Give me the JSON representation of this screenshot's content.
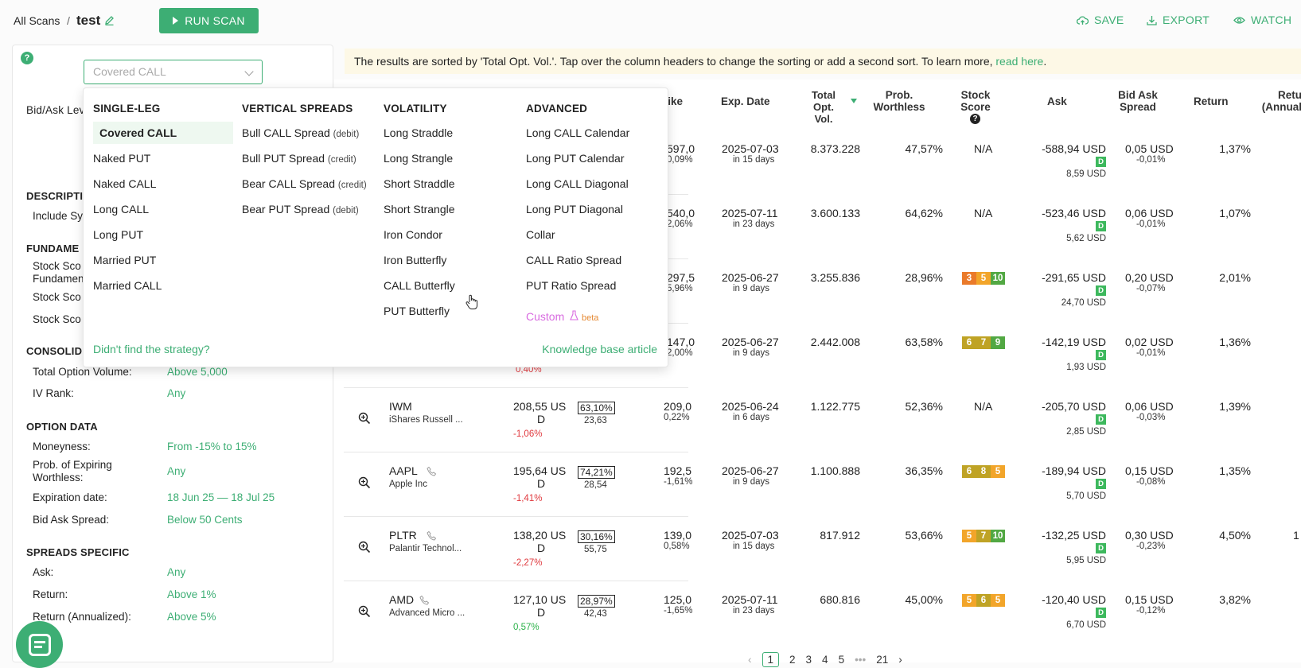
{
  "breadcrumb": {
    "root": "All Scans",
    "separator": "/",
    "scan_name": "test"
  },
  "toolbar": {
    "run_label": "RUN SCAN",
    "save_label": "SAVE",
    "export_label": "EXPORT",
    "watch_label": "WATCH"
  },
  "colors": {
    "accent": "#3dae74",
    "banner_bg": "#fdf8e6",
    "negative": "#e0393e",
    "positive": "#2cb24a"
  },
  "left_panel": {
    "help": "?",
    "strategy_placeholder": "Covered CALL",
    "bid_ask_label": "Bid/Ask Lev",
    "sections": {
      "description": "DESCRIPTI",
      "include": "Include Sy",
      "fundamentals": "FUNDAME",
      "score1": "Stock Sco",
      "score1b": "Fundamen",
      "score2": "Stock Sco",
      "score3": "Stock Sco",
      "consolidated": "CONSOLID",
      "total_vol_label": "Total Option Volume:",
      "total_vol_value": "Above 5,000",
      "iv_rank_label": "IV Rank:",
      "iv_rank_value": "Any",
      "option_data": "OPTION DATA",
      "moneyness_label": "Moneyness:",
      "moneyness_value": "From -15% to 15%",
      "prob_label": "Prob. of Expiring Worthless:",
      "prob_value": "Any",
      "exp_label": "Expiration date:",
      "exp_value": "18 Jun 25 — 18 Jul 25",
      "spread_label": "Bid Ask Spread:",
      "spread_value": "Below 50 Cents",
      "spreads_specific": "SPREADS SPECIFIC",
      "ask_label": "Ask:",
      "ask_value": "Any",
      "return_label": "Return:",
      "return_value": "Above 1%",
      "return_ann_label": "Return (Annualized):",
      "return_ann_value": "Above 5%"
    }
  },
  "dropdown": {
    "columns": [
      {
        "title": "SINGLE-LEG",
        "items": [
          {
            "label": "Covered CALL",
            "note": ""
          },
          {
            "label": "Naked PUT",
            "note": ""
          },
          {
            "label": "Naked CALL",
            "note": ""
          },
          {
            "label": "Long CALL",
            "note": ""
          },
          {
            "label": "Long PUT",
            "note": ""
          },
          {
            "label": "Married PUT",
            "note": ""
          },
          {
            "label": "Married CALL",
            "note": ""
          }
        ]
      },
      {
        "title": "VERTICAL SPREADS",
        "items": [
          {
            "label": "Bull CALL Spread",
            "note": "(debit)"
          },
          {
            "label": "Bull PUT Spread",
            "note": "(credit)"
          },
          {
            "label": "Bear CALL Spread",
            "note": "(credit)"
          },
          {
            "label": "Bear PUT Spread",
            "note": "(debit)"
          }
        ]
      },
      {
        "title": "VOLATILITY",
        "items": [
          {
            "label": "Long Straddle",
            "note": ""
          },
          {
            "label": "Long Strangle",
            "note": ""
          },
          {
            "label": "Short Straddle",
            "note": ""
          },
          {
            "label": "Short Strangle",
            "note": ""
          },
          {
            "label": "Iron Condor",
            "note": ""
          },
          {
            "label": "Iron Butterfly",
            "note": ""
          },
          {
            "label": "CALL Butterfly",
            "note": ""
          },
          {
            "label": "PUT Butterfly",
            "note": ""
          }
        ]
      },
      {
        "title": "ADVANCED",
        "items": [
          {
            "label": "Long CALL Calendar",
            "note": ""
          },
          {
            "label": "Long PUT Calendar",
            "note": ""
          },
          {
            "label": "Long CALL Diagonal",
            "note": ""
          },
          {
            "label": "Long PUT Diagonal",
            "note": ""
          },
          {
            "label": "Collar",
            "note": ""
          },
          {
            "label": "CALL Ratio Spread",
            "note": ""
          },
          {
            "label": "PUT Ratio Spread",
            "note": ""
          }
        ]
      }
    ],
    "custom_label": "Custom",
    "custom_beta": "beta",
    "not_found": "Didn't find the strategy?",
    "kb_article": "Knowledge base article"
  },
  "banner": {
    "text": "The results are sorted by 'Total Opt. Vol.'. Tap over the column headers to change the sorting or add a second sort. To learn more, ",
    "link": "read here",
    "end": "."
  },
  "table": {
    "headers": {
      "strike": "rike",
      "exp": "Exp. Date",
      "vol": "Total Opt. Vol.",
      "prob": "Prob. Worthless",
      "score": "Stock Score",
      "ask": "Ask",
      "spread": "Bid Ask Spread",
      "ret": "Return",
      "ret_ann": "Retu (Annual"
    },
    "rows": [
      {
        "sym": "",
        "name": "",
        "price": "",
        "price2": "",
        "chg": "",
        "iv": "",
        "iv2": "",
        "strike": "597,0",
        "strike_chg": "0,09%",
        "exp": "2025-07-03",
        "exp_in": "in 15 days",
        "vol": "8.373.228",
        "prob": "47,57%",
        "score": "N/A",
        "scores": [],
        "ask": "-588,94 USD",
        "ask2": "8,59 USD",
        "spread": "0,05 USD",
        "spread2": "-0,01%",
        "ret": "1,37%",
        "ret_ann": ""
      },
      {
        "sym": "",
        "name": "",
        "price": "",
        "price2": "",
        "chg": "",
        "iv": "",
        "iv2": "",
        "strike": "540,0",
        "strike_chg": "2,06%",
        "exp": "2025-07-11",
        "exp_in": "in 23 days",
        "vol": "3.600.133",
        "prob": "64,62%",
        "score": "N/A",
        "scores": [],
        "ask": "-523,46 USD",
        "ask2": "5,62 USD",
        "spread": "0,06 USD",
        "spread2": "-0,01%",
        "ret": "1,07%",
        "ret_ann": ""
      },
      {
        "sym": "",
        "name": "",
        "price": "",
        "price2": "",
        "chg": "",
        "iv": "",
        "iv2": "",
        "strike": "297,5",
        "strike_chg": "5,96%",
        "exp": "2025-06-27",
        "exp_in": "in 9 days",
        "vol": "3.255.836",
        "prob": "28,96%",
        "score": "",
        "scores": [
          "3",
          "5",
          "10"
        ],
        "ask": "-291,65 USD",
        "ask2": "24,70 USD",
        "spread": "0,20 USD",
        "spread2": "-0,07%",
        "ret": "2,01%",
        "ret_ann": ""
      },
      {
        "sym": "",
        "name": "",
        "price": "",
        "price2": "",
        "chg": "0,40%",
        "iv": "",
        "iv2": "",
        "strike": "147,0",
        "strike_chg": "2,00%",
        "exp": "2025-06-27",
        "exp_in": "in 9 days",
        "vol": "2.442.008",
        "prob": "63,58%",
        "score": "",
        "scores": [
          "6",
          "7",
          "9"
        ],
        "ask": "-142,19 USD",
        "ask2": "1,93 USD",
        "spread": "0,02 USD",
        "spread2": "-0,01%",
        "ret": "1,36%",
        "ret_ann": ""
      },
      {
        "sym": "IWM",
        "name": "iShares Russell ...",
        "price": "208,55 US",
        "price2": "D",
        "chg": "-1,06%",
        "iv": "63,10%",
        "iv2": "23,63",
        "strike": "209,0",
        "strike_chg": "0,22%",
        "exp": "2025-06-24",
        "exp_in": "in 6 days",
        "vol": "1.122.775",
        "prob": "52,36%",
        "score": "N/A",
        "scores": [],
        "ask": "-205,70 USD",
        "ask2": "2,85 USD",
        "spread": "0,06 USD",
        "spread2": "-0,03%",
        "ret": "1,39%",
        "ret_ann": ""
      },
      {
        "sym": "AAPL",
        "name": "Apple Inc",
        "price": "195,64 US",
        "price2": "D",
        "chg": "-1,41%",
        "iv": "74,21%",
        "iv2": "28,54",
        "strike": "192,5",
        "strike_chg": "-1,61%",
        "exp": "2025-06-27",
        "exp_in": "in 9 days",
        "vol": "1.100.888",
        "prob": "36,35%",
        "score": "",
        "scores": [
          "6",
          "8",
          "5"
        ],
        "ask": "-189,94 USD",
        "ask2": "5,70 USD",
        "spread": "0,15 USD",
        "spread2": "-0,08%",
        "ret": "1,35%",
        "ret_ann": ""
      },
      {
        "sym": "PLTR",
        "name": "Palantir Technol...",
        "price": "138,20 US",
        "price2": "D",
        "chg": "-2,27%",
        "iv": "30,16%",
        "iv2": "55,75",
        "strike": "139,0",
        "strike_chg": "0,58%",
        "exp": "2025-07-03",
        "exp_in": "in 15 days",
        "vol": "817.912",
        "prob": "53,66%",
        "score": "",
        "scores": [
          "5",
          "7",
          "10"
        ],
        "ask": "-132,25 USD",
        "ask2": "5,95 USD",
        "spread": "0,30 USD",
        "spread2": "-0,23%",
        "ret": "4,50%",
        "ret_ann": "1"
      },
      {
        "sym": "AMD",
        "name": "Advanced Micro ...",
        "price": "127,10 US",
        "price2": "D",
        "chg": "0,57%",
        "iv": "28,97%",
        "iv2": "42,43",
        "strike": "125,0",
        "strike_chg": "-1,65%",
        "exp": "2025-07-11",
        "exp_in": "in 23 days",
        "vol": "680.816",
        "prob": "45,00%",
        "score": "",
        "scores": [
          "5",
          "6",
          "5"
        ],
        "ask": "-120,40 USD",
        "ask2": "6,70 USD",
        "spread": "0,15 USD",
        "spread2": "-0,12%",
        "ret": "3,82%",
        "ret_ann": ""
      }
    ],
    "d_badge": "D"
  },
  "pager": {
    "prev": "‹",
    "pages": [
      "1",
      "2",
      "3",
      "4",
      "5"
    ],
    "ellipsis": "•••",
    "last": "21",
    "next": "›"
  }
}
